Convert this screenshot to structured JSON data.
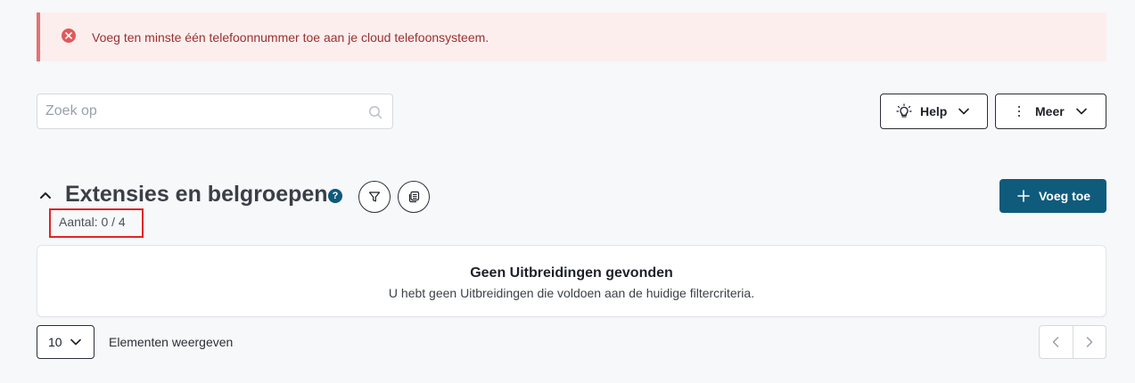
{
  "alert": {
    "message": "Voeg ten minste één telefoonnummer toe aan je cloud telefoonsysteem.",
    "icon": "error-circle-icon",
    "color": "#e05a5a"
  },
  "search": {
    "placeholder": "Zoek op",
    "value": ""
  },
  "toolbar": {
    "help_label": "Help",
    "more_label": "Meer"
  },
  "section": {
    "title": "Extensies en belgroepen",
    "help_badge": "?",
    "count": "Aantal: 0 / 4",
    "add_label": "Voeg toe"
  },
  "empty_state": {
    "title": "Geen Uitbreidingen gevonden",
    "subtitle": "U hebt geen Uitbreidingen die voldoen aan de huidige filtercriteria."
  },
  "pagination": {
    "page_size": "10",
    "page_size_label": "Elementen weergeven"
  },
  "colors": {
    "primary": "#0f5b7b",
    "alert_bg": "#fdeeee",
    "highlight": "#e02424"
  }
}
